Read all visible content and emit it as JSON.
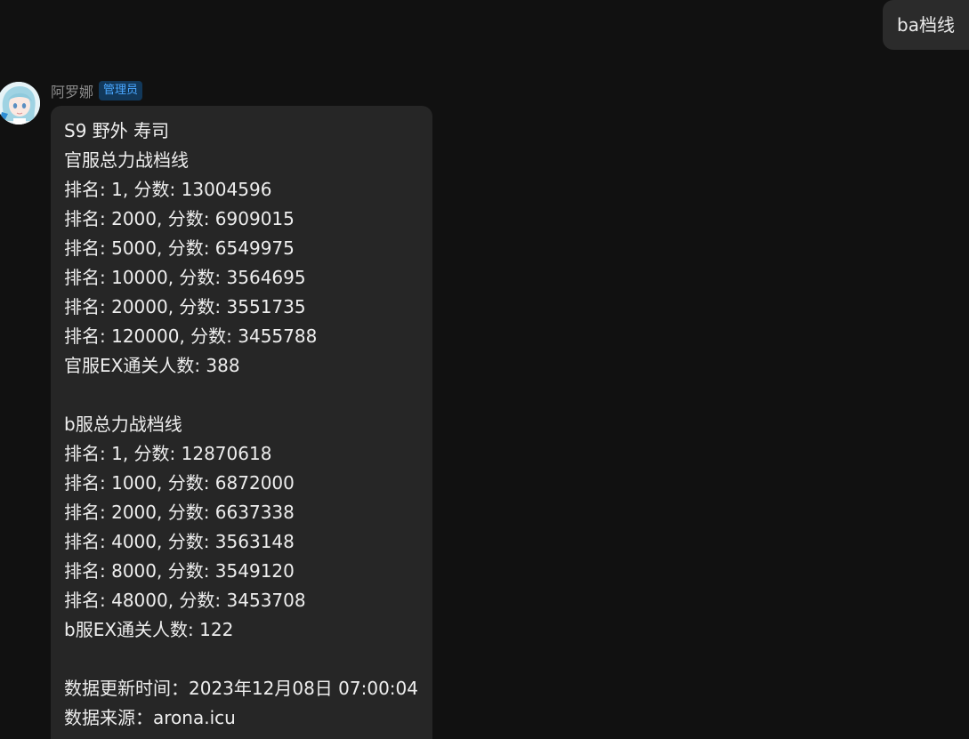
{
  "user_message": {
    "text": "ba档线"
  },
  "reply": {
    "sender": {
      "name": "阿罗娜",
      "role": "管理员"
    },
    "lines": [
      "S9 野外 寿司",
      "官服总力战档线",
      "排名: 1, 分数: 13004596",
      "排名: 2000, 分数: 6909015",
      "排名: 5000, 分数: 6549975",
      "排名: 10000, 分数: 3564695",
      "排名: 20000, 分数: 3551735",
      "排名: 120000, 分数: 3455788",
      "官服EX通关人数: 388",
      "",
      "b服总力战档线",
      "排名: 1, 分数: 12870618",
      "排名: 1000, 分数: 6872000",
      "排名: 2000, 分数: 6637338",
      "排名: 4000, 分数: 3563148",
      "排名: 8000, 分数: 3549120",
      "排名: 48000, 分数: 3453708",
      "b服EX通关人数: 122",
      "",
      "数据更新时间：2023年12月08日 07:00:04",
      "数据来源：arona.icu"
    ]
  }
}
